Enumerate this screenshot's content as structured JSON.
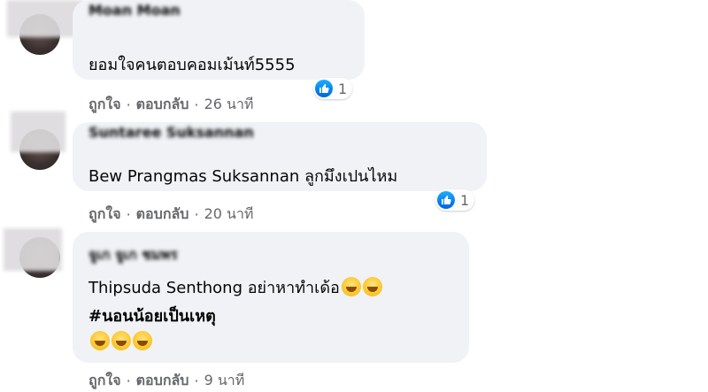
{
  "comments": [
    {
      "author": "Moan Moan",
      "text_lines": [
        "ยอมใจคนตอบคอมเม้นท์5555"
      ],
      "reaction_count": "1",
      "actions": {
        "like": "ถูกใจ",
        "reply": "ตอบกลับ",
        "time": "26 นาที"
      }
    },
    {
      "author": "Suntaree Suksannan",
      "mention": "Bew Prangmas Suksannan",
      "text_rest": "ลูกมึงเปนไหม",
      "reaction_count": "1",
      "actions": {
        "like": "ถูกใจ",
        "reply": "ตอบกลับ",
        "time": "20 นาที"
      }
    },
    {
      "author": "จูเก จูเก ชมพร",
      "mention": "Thipsuda Senthong",
      "text_rest": "อย่าหาทำเด้อ",
      "hashtag": "#นอนน้อยเป็นเหตุ",
      "emoji_names": [
        "rofl-emoji",
        "rofl-emoji",
        "grinning-sweat-emoji",
        "grinning-sweat-emoji",
        "grinning-sweat-emoji"
      ],
      "actions": {
        "like": "ถูกใจ",
        "reply": "ตอบกลับ",
        "time": "9 นาที"
      }
    }
  ],
  "separator": "·",
  "colors": {
    "bubble": "#f0f2f5",
    "meta": "#65676b",
    "like_blue": "#1877f2"
  }
}
